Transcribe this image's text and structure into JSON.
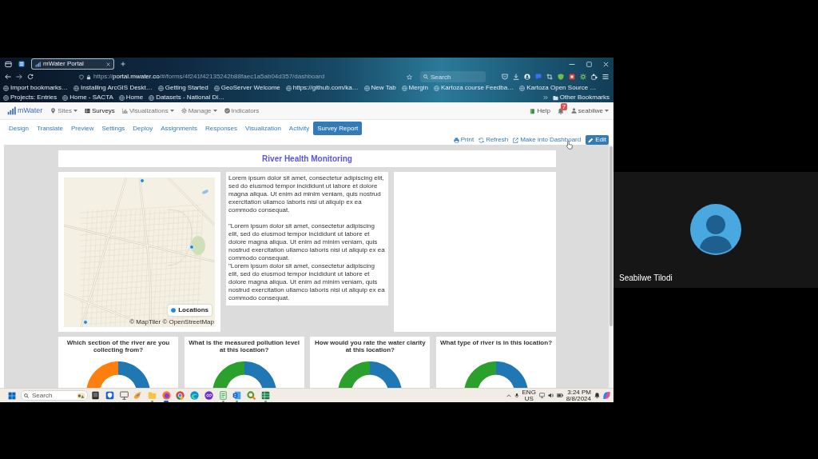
{
  "browser": {
    "tabs": [
      {
        "title": "mWater Portal",
        "selected": true
      }
    ],
    "url": "https://**portal.mwater.co**/#/forms/4f241f42135242b88faec1a5ab04d357/dashboard",
    "search": {
      "placeholder": "Search"
    },
    "bookmarks": [
      {
        "label": "Import bookmarks…"
      },
      {
        "label": "Installing ArcGIS Deskt…"
      },
      {
        "label": "Getting Started"
      },
      {
        "label": "GeoServer Welcome"
      },
      {
        "label": "https://github.com/ka…"
      },
      {
        "label": "New Tab"
      },
      {
        "label": "Mergin"
      },
      {
        "label": "Kartoza course Feedba…"
      },
      {
        "label": "Kartoza Open Source …"
      },
      {
        "label": "Projects: Entries"
      },
      {
        "label": "Home - SACTA"
      },
      {
        "label": "Home"
      },
      {
        "label": "Datasets - National Di…"
      }
    ],
    "other_bookmarks": "Other Bookmarks"
  },
  "app": {
    "brand": "mWater",
    "nav": [
      {
        "label": "Sites",
        "dropdown": true,
        "selected": false
      },
      {
        "label": "Surveys",
        "dropdown": false,
        "selected": true
      },
      {
        "label": "Visualizations",
        "dropdown": true,
        "selected": false
      },
      {
        "label": "Manage",
        "dropdown": true,
        "selected": false
      },
      {
        "label": "Indicators",
        "dropdown": false,
        "selected": false
      }
    ],
    "help": "Help",
    "notification_count": "7",
    "user": "seabilwe",
    "tabs": [
      {
        "label": "Design",
        "selected": false
      },
      {
        "label": "Translate",
        "selected": false
      },
      {
        "label": "Preview",
        "selected": false
      },
      {
        "label": "Settings",
        "selected": false
      },
      {
        "label": "Deploy",
        "selected": false
      },
      {
        "label": "Assignments",
        "selected": false
      },
      {
        "label": "Responses",
        "selected": false
      },
      {
        "label": "Visualization",
        "selected": false
      },
      {
        "label": "Activity",
        "selected": false
      },
      {
        "label": "Survey Report",
        "selected": true
      }
    ],
    "actions": [
      {
        "label": "Print",
        "kind": "link"
      },
      {
        "label": "Refresh",
        "kind": "link"
      },
      {
        "label": "Make into Dashboard",
        "kind": "link"
      },
      {
        "label": "Edit",
        "kind": "button"
      }
    ]
  },
  "report": {
    "title": "River Health Monitoring",
    "map": {
      "legend": [
        {
          "label": "Locations",
          "color": "#1e88e5"
        }
      ],
      "attribution": "© MapTiler © OpenStreetMap"
    },
    "paragraphs": [
      "Lorem ipsum dolor sit amet, consectetur adipiscing elit, sed do eiusmod tempor incididunt ut labore et dolore magna aliqua. Ut enim ad minim veniam, quis nostrud exercitation ullamco laboris nisi ut aliquip ex ea commodo consequat.",
      "\"Lorem ipsum dolor sit amet, consectetur adipiscing elit, sed do eiusmod tempor incididunt ut labore et dolore magna aliqua. Ut enim ad minim veniam, quis nostrud exercitation ullamco laboris nisi ut aliquip ex ea commodo consequat.",
      "\"Lorem ipsum dolor sit amet, consectetur adipiscing elit, sed do eiusmod tempor incididunt ut labore et dolore magna aliqua. Ut enim ad minim veniam, quis nostrud exercitation ullamco laboris nisi ut aliquip ex ea commodo consequat."
    ],
    "charts": [
      {
        "title": "Which section of the river are you collecting from?",
        "slices": [
          {
            "color": "#1f77b4"
          },
          {
            "color": "#ff7f0e"
          }
        ]
      },
      {
        "title": "What is the measured pollution level at this location?",
        "slices": [
          {
            "color": "#1f77b4"
          },
          {
            "color": "#2ca02c"
          }
        ]
      },
      {
        "title": "How would you rate the water clarity at this location?",
        "slices": [
          {
            "color": "#1f77b4"
          },
          {
            "color": "#2ca02c"
          }
        ]
      },
      {
        "title": "What type of river is in this location?",
        "slices": [
          {
            "color": "#1f77b4"
          },
          {
            "color": "#2ca02c"
          }
        ]
      }
    ]
  },
  "taskbar": {
    "search": {
      "placeholder": "Search"
    },
    "apps": [
      {
        "running": false,
        "active": false
      },
      {
        "running": false,
        "active": false
      },
      {
        "running": false,
        "active": false
      },
      {
        "running": false,
        "active": false
      },
      {
        "running": true,
        "active": false
      },
      {
        "running": true,
        "active": true
      },
      {
        "running": false,
        "active": false
      },
      {
        "running": false,
        "active": false
      },
      {
        "running": false,
        "active": false
      },
      {
        "running": true,
        "active": false
      },
      {
        "running": true,
        "active": false
      },
      {
        "running": false,
        "active": false
      },
      {
        "running": true,
        "active": false
      }
    ],
    "language": [
      "ENG",
      "US"
    ],
    "time": "3:24 PM",
    "date": "8/8/2024"
  },
  "participant": {
    "name": "Seabilwe Tilodi"
  }
}
